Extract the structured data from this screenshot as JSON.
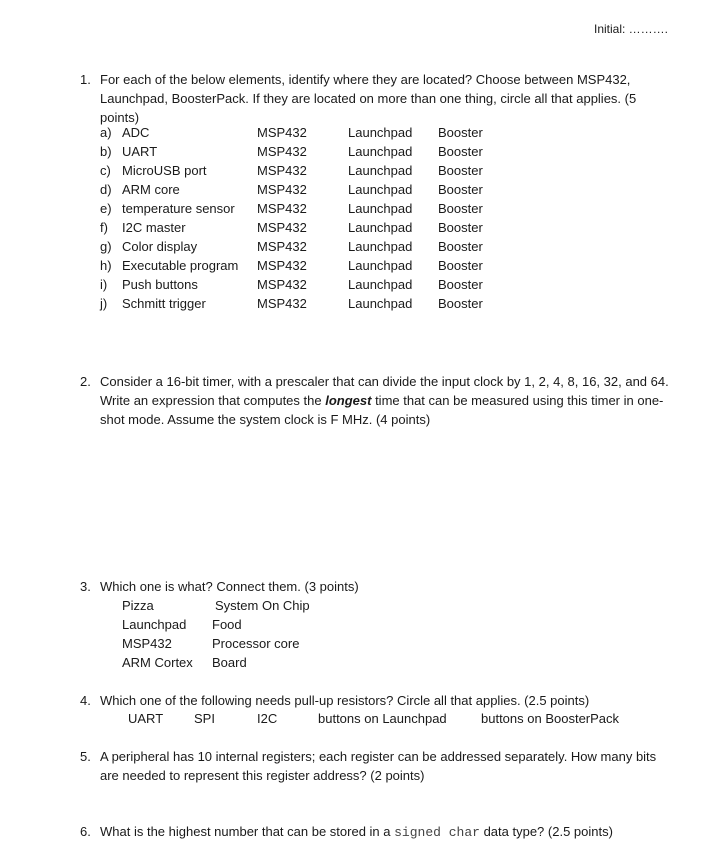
{
  "header": {
    "initial": "Initial: ………."
  },
  "q1": {
    "number": "1.",
    "text": "For each of the below elements, identify where they are located? Choose between MSP432, Launchpad, BoosterPack. If they are located on more than one thing, circle all that applies. (5 points)",
    "choices": [
      "MSP432",
      "Launchpad",
      "Booster"
    ],
    "items": [
      {
        "label": "a)",
        "name": "ADC"
      },
      {
        "label": "b)",
        "name": "UART"
      },
      {
        "label": "c)",
        "name": "MicroUSB port"
      },
      {
        "label": "d)",
        "name": "ARM core"
      },
      {
        "label": "e)",
        "name": "temperature sensor"
      },
      {
        "label": "f)",
        "name": "I2C master"
      },
      {
        "label": "g)",
        "name": "Color display"
      },
      {
        "label": "h)",
        "name": "Executable program"
      },
      {
        "label": "i)",
        "name": "Push buttons"
      },
      {
        "label": "j)",
        "name": "Schmitt trigger"
      }
    ]
  },
  "q2": {
    "number": "2.",
    "text_before": "Consider a 16-bit timer, with a prescaler that can divide the input clock by 1, 2, 4, 8, 16, 32, and 64. Write an expression that computes the ",
    "emphasis": "longest",
    "text_after": " time that can be measured using this timer in one-shot mode. Assume the system clock is F MHz. (4 points)"
  },
  "q3": {
    "number": "3.",
    "text": "Which one is what?  Connect them.  (3 points)",
    "left": [
      "Pizza",
      "Launchpad",
      "MSP432",
      "ARM Cortex"
    ],
    "right": [
      "System On Chip",
      "Food",
      "Processor core",
      "Board"
    ]
  },
  "q4": {
    "number": "4.",
    "text": "Which one of the following needs pull-up resistors? Circle all that applies. (2.5 points)",
    "options": [
      "UART",
      "SPI",
      "I2C",
      "buttons on Launchpad",
      "buttons on BoosterPack"
    ]
  },
  "q5": {
    "number": "5.",
    "text": "A peripheral has 10 internal registers; each register can be addressed separately. How many bits are needed to represent this register address? (2 points)"
  },
  "q6": {
    "number": "6.",
    "text_before": "What is the highest number that can be stored in a ",
    "code": "signed char",
    "text_after": " data type? (2.5 points)"
  }
}
